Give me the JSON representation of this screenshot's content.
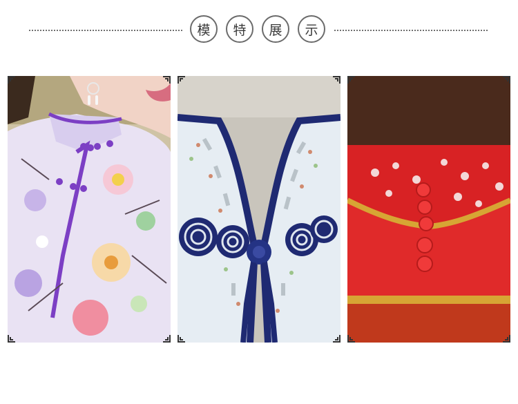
{
  "header": {
    "title_chars": [
      "模",
      "特",
      "展",
      "示"
    ]
  },
  "colors": {
    "divider": "#6f6f6f",
    "circle_border": "#6b6b6b",
    "text": "#3a3a3a",
    "panel1_dress": "#e9e2f3",
    "panel1_trim": "#7c3fc4",
    "panel2_fabric": "#e6edf3",
    "panel2_trim": "#1f2a72",
    "panel3_fabric": "#e02a2a",
    "panel3_gold": "#d7a534"
  },
  "panels": [
    {
      "name": "lavender-floral-qipao-photo",
      "icon": "photo-icon"
    },
    {
      "name": "navy-trim-beaded-collar-photo",
      "icon": "photo-icon"
    },
    {
      "name": "red-gold-embroidered-clutch-photo",
      "icon": "photo-icon"
    }
  ]
}
